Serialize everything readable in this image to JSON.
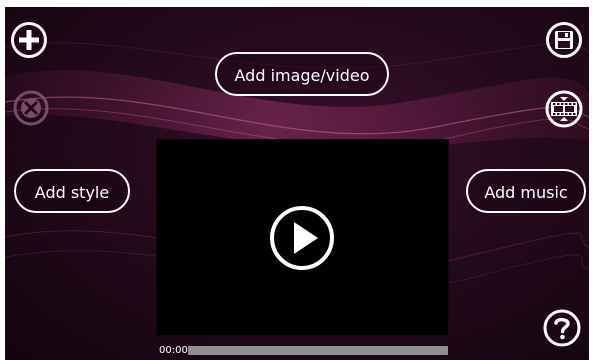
{
  "toolbar": {
    "add_icon": "plus-circle-icon",
    "remove_icon": "close-circle-icon",
    "save_icon": "floppy-disk-icon",
    "film_icon": "film-reel-icon",
    "help_icon": "question-circle-icon"
  },
  "buttons": {
    "add_media": "Add image/video",
    "add_style": "Add style",
    "add_music": "Add music"
  },
  "player": {
    "play_icon": "play-icon",
    "current_time": "00:00",
    "progress": 0
  },
  "colors": {
    "background_dark": "#14040f",
    "background_glow": "#3a0f2c",
    "wave_highlight": "#c2307a",
    "foreground": "#ffffff",
    "disabled": "#7a4c66",
    "seek_track": "#8f8f8f"
  }
}
